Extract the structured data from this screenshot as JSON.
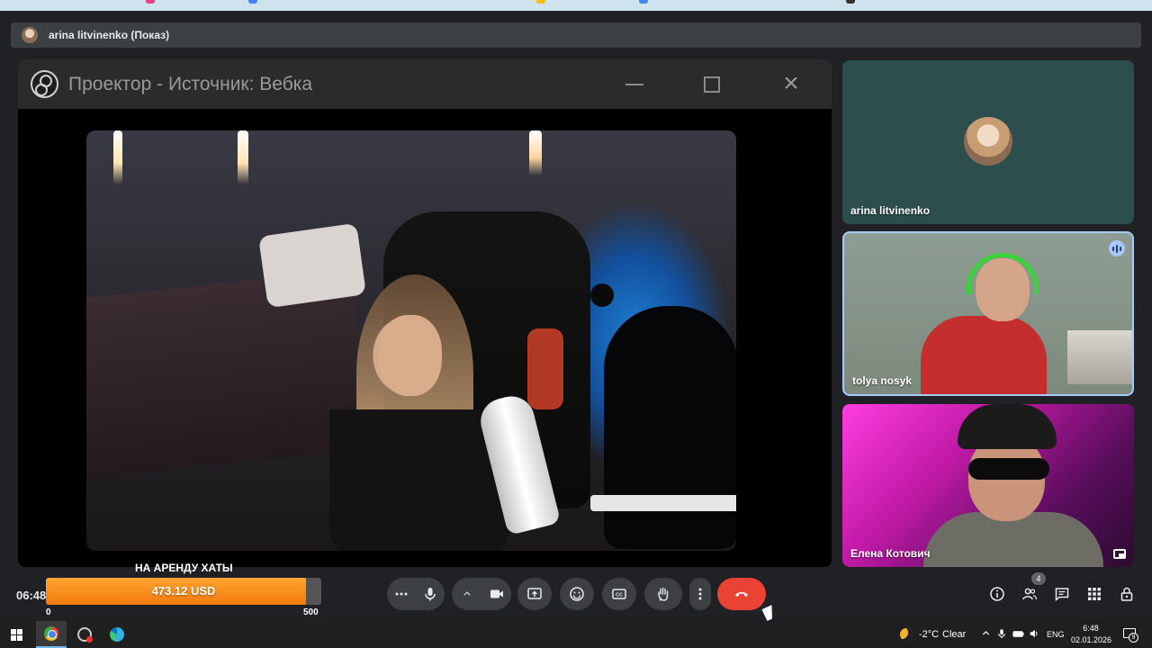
{
  "presenter_bar": {
    "label": "arina litvinenko (Показ)"
  },
  "obs_window": {
    "title": "Проектор - Источник: Вебка"
  },
  "participants": [
    {
      "name": "arina litvinenko"
    },
    {
      "name": "tolya nosyk"
    },
    {
      "name": "Елена Котович"
    }
  ],
  "meeting": {
    "time": "06:48"
  },
  "donation": {
    "label": "НА АРЕНДУ ХАТЫ",
    "amount": "473.12 USD",
    "min": "0",
    "max": "500",
    "progress": 0.946
  },
  "controls": {
    "people_badge": "4",
    "icons": [
      "more-options-icon",
      "microphone-icon",
      "chevron-up-icon",
      "camera-icon",
      "present-screen-icon",
      "emoji-icon",
      "captions-icon",
      "raise-hand-icon",
      "more-vert-icon",
      "hang-up-icon",
      "info-icon",
      "people-icon",
      "chat-icon",
      "activities-icon",
      "host-controls-icon"
    ]
  },
  "taskbar": {
    "weather_temp": "-2°C",
    "weather_desc": "Clear",
    "lang": "ENG",
    "time": "6:48",
    "date": "02.01.2026",
    "notifications": "9"
  },
  "colors": {
    "hangup": "#ea4335",
    "donation_fill": "#f7931e",
    "active_speaker_border": "#a8c7fa",
    "control_bg": "#3c4043"
  }
}
